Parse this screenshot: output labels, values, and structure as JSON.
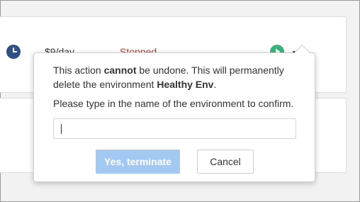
{
  "environment_row": {
    "cost": "$9/day",
    "status": "Stopped",
    "status_color": "#c0392b",
    "icons": [
      "clock-icon",
      "play-icon",
      "more-icon"
    ]
  },
  "terminate_popover": {
    "warning": {
      "prefix": "This action ",
      "emphasis": "cannot",
      "middle": " be undone. This will permanently delete the environment ",
      "environment_name": "Healthy Env",
      "suffix": "."
    },
    "prompt": "Please type in the name of the environment to confirm.",
    "input_value": "",
    "confirm_label": "Yes, terminate",
    "cancel_label": "Cancel",
    "confirm_color": "#a3c8f1"
  }
}
